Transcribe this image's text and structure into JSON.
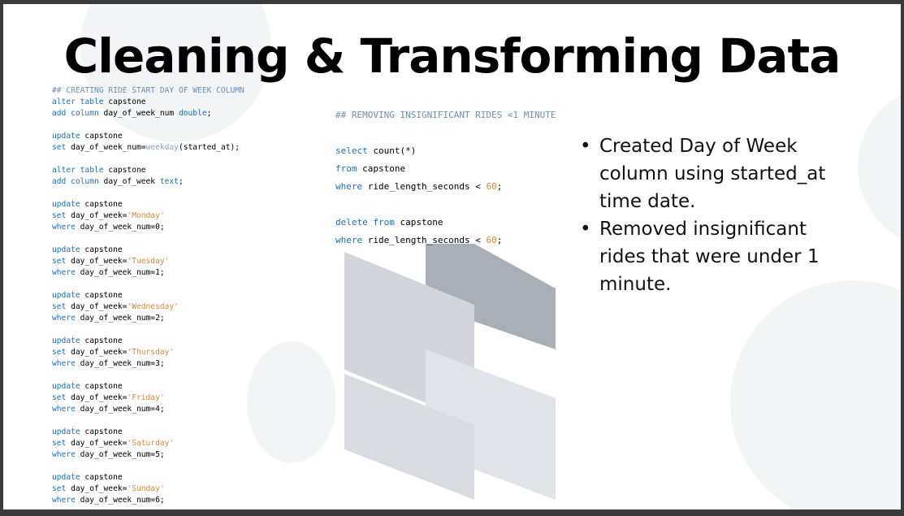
{
  "slide": {
    "title": "Cleaning & Transforming Data"
  },
  "code_left": {
    "comment": "## CREATING RIDE START DAY OF WEEK COLUMN",
    "l_alter1_kw": "alter table",
    "l_alter1_tbl": " capstone",
    "l_add1_kw": "add column",
    "l_add1_col": " day_of_week_num ",
    "l_add1_type": "double",
    "l_add1_end": ";",
    "l_upd0_kw": "update",
    "l_upd0_tbl": " capstone",
    "l_set0_kw": "set",
    "l_set0_expr": " day_of_week_num=",
    "l_set0_fn": "weekday",
    "l_set0_arg": "(started_at);",
    "l_alter2_kw": "alter table",
    "l_alter2_tbl": " capstone",
    "l_add2_kw": "add column",
    "l_add2_col": " day_of_week ",
    "l_add2_type": "text",
    "l_add2_end": ";",
    "update_kw": "update",
    "set_kw": "set",
    "where_kw": "where",
    "table": " capstone",
    "set_prefix": " day_of_week=",
    "days": [
      {
        "name": "'Monday'",
        "where": " day_of_week_num=0;"
      },
      {
        "name": "'Tuesday'",
        "where": " day_of_week_num=1;"
      },
      {
        "name": "'Wednesday'",
        "where": " day_of_week_num=2;"
      },
      {
        "name": "'Thursday'",
        "where": " day_of_week_num=3;"
      },
      {
        "name": "'Friday'",
        "where": " day_of_week_num=4;"
      },
      {
        "name": "'Saturday'",
        "where": " day_of_week_num=5;"
      },
      {
        "name": "'Sunday'",
        "where": " day_of_week_num=6;"
      }
    ]
  },
  "code_right": {
    "comment": "## REMOVING INSIGNIFICANT RIDES <1 MINUTE",
    "select_kw": "select",
    "select_expr": " count(*)",
    "from_kw": "from",
    "table": " capstone",
    "where_kw": "where",
    "where_expr": " ride_length_seconds < ",
    "value": "60",
    "semicolon": ";",
    "delete_kw": "delete from"
  },
  "bullets": [
    "Created Day of Week column using started_at time date.",
    "Removed insignificant rides that were under 1 minute."
  ],
  "colors": {
    "keyword": "#1c6fbf",
    "comment": "#6a8fb8",
    "string": "#d48a3c",
    "window_frame": "#3a3a3a"
  }
}
